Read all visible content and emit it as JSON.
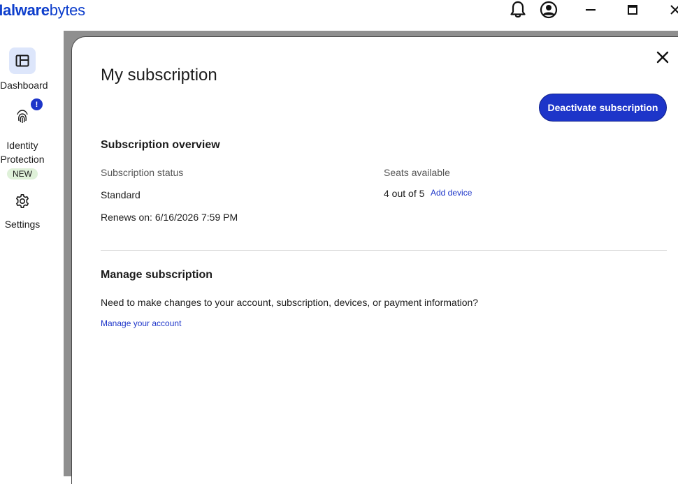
{
  "app": {
    "logo_bold": "Malware",
    "logo_light": "bytes"
  },
  "titlebar": {
    "icons": [
      "bell-icon",
      "account-icon",
      "minimize-icon",
      "maximize-icon",
      "close-icon"
    ]
  },
  "sidebar": {
    "items": [
      {
        "label": "Dashboard",
        "icon": "dashboard-icon",
        "active": true
      },
      {
        "label_line1": "Identity",
        "label_line2": "Protection",
        "icon": "fingerprint-icon",
        "badge": "!",
        "tag": "NEW"
      },
      {
        "label": "Settings",
        "icon": "gear-icon"
      }
    ]
  },
  "subscription": {
    "title": "My subscription",
    "deactivate_label": "Deactivate subscription",
    "overview": {
      "heading": "Subscription overview",
      "status_label": "Subscription status",
      "status_value": "Standard",
      "renews": "Renews on: 6/16/2026 7:59 PM",
      "seats_label": "Seats available",
      "seats_value": "4 out of 5",
      "add_device_label": "Add device"
    },
    "manage": {
      "heading": "Manage subscription",
      "description": "Need to make changes to your account, subscription, devices, or payment information?",
      "link_label": "Manage your account"
    }
  },
  "colors": {
    "accent": "#1d35c9",
    "brand": "#0d3ecc",
    "backdrop": "#8f8f8f",
    "new_tag_bg": "#dff1d9",
    "active_nav_bg": "#dde6fb"
  }
}
